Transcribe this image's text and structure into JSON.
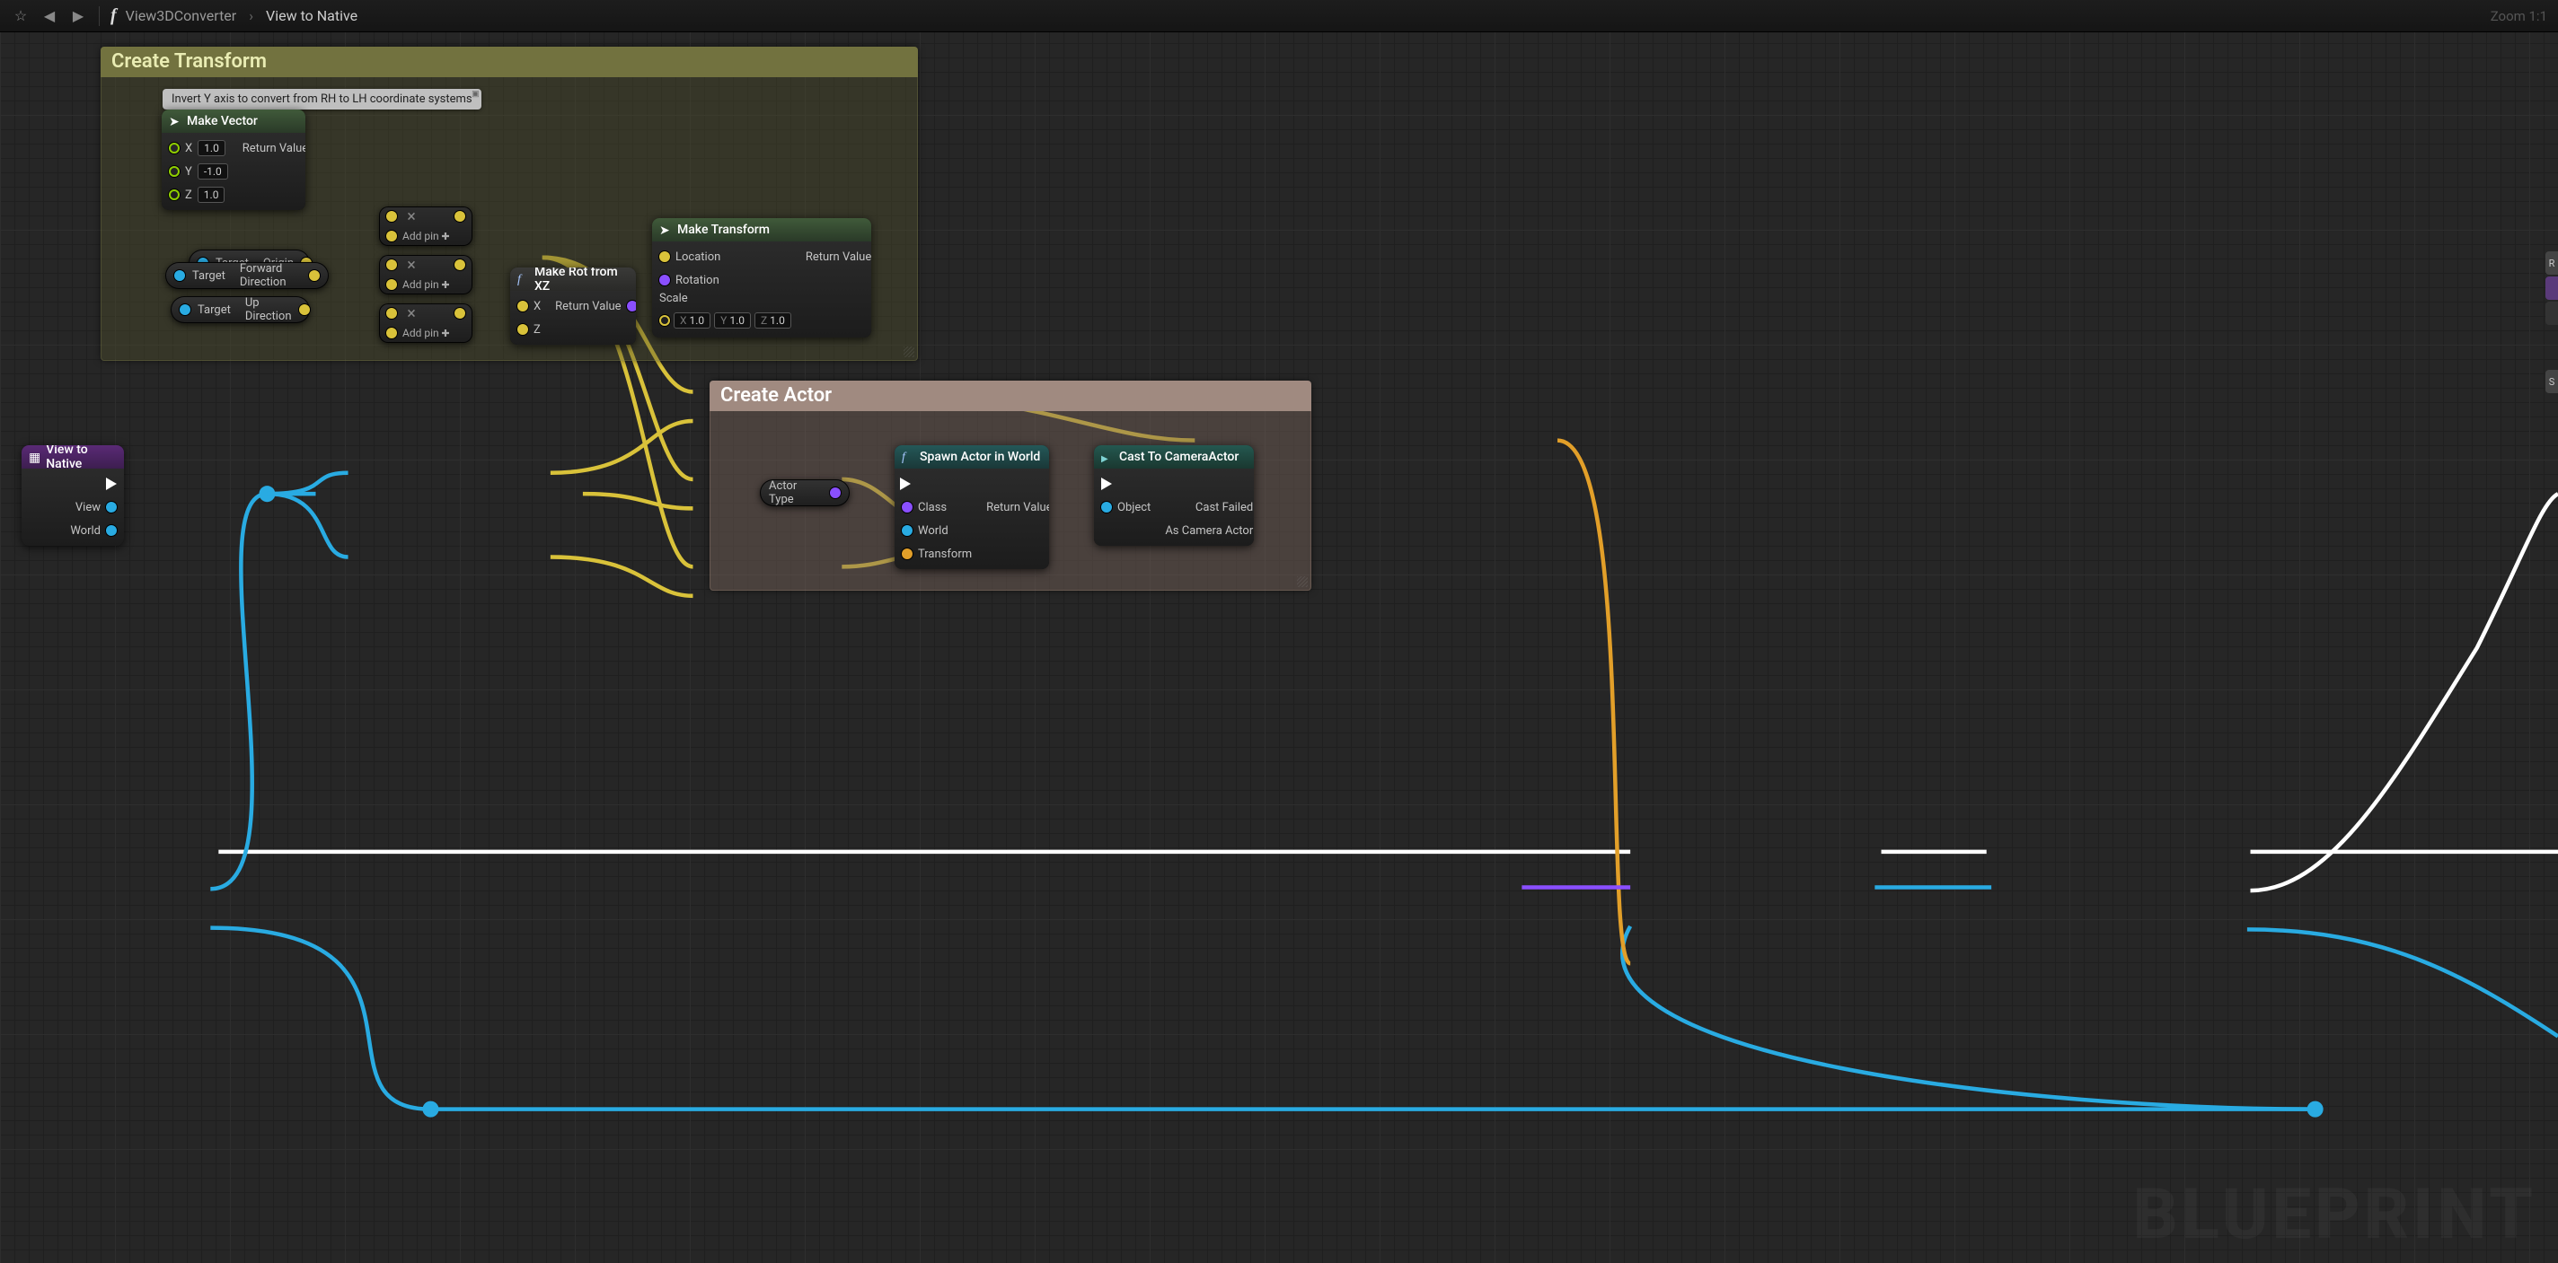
{
  "toolbar": {
    "crumbs": [
      "View3DConverter",
      "View to Native"
    ],
    "zoom": "Zoom 1:1"
  },
  "watermark": "BLUEPRINT",
  "groups": {
    "transform": {
      "title": "Create Transform"
    },
    "actor": {
      "title": "Create Actor"
    }
  },
  "note": {
    "text": "Invert Y axis to convert from RH to LH coordinate systems"
  },
  "nodes": {
    "makeVector": {
      "title": "Make Vector",
      "x": {
        "label": "X",
        "value": "1.0"
      },
      "y": {
        "label": "Y",
        "value": "-1.0"
      },
      "z": {
        "label": "Z",
        "value": "1.0"
      },
      "out": "Return Value"
    },
    "chips": {
      "origin": {
        "left": "Target",
        "right": "Origin"
      },
      "fwd": {
        "left": "Target",
        "right": "Forward Direction"
      },
      "up": {
        "left": "Target",
        "right": "Up Direction"
      },
      "actorType": {
        "label": "Actor Type"
      }
    },
    "mult": {
      "addpin": "Add pin"
    },
    "makeRot": {
      "title": "Make Rot from XZ",
      "x": "X",
      "z": "Z",
      "out": "Return Value"
    },
    "makeTransform": {
      "title": "Make Transform",
      "location": "Location",
      "rotation": "Rotation",
      "scale": "Scale",
      "sx": "1.0",
      "sy": "1.0",
      "sz": "1.0",
      "out": "Return Value"
    },
    "viewToNative": {
      "title": "View to Native",
      "view": "View",
      "world": "World"
    },
    "spawn": {
      "title": "Spawn Actor in World",
      "class": "Class",
      "world": "World",
      "transform": "Transform",
      "out": "Return Value"
    },
    "cast": {
      "title": "Cast To CameraActor",
      "object": "Object",
      "fail": "Cast Failed",
      "as": "As Camera Actor"
    }
  },
  "sideTabs": [
    "R",
    "",
    "",
    "S"
  ]
}
